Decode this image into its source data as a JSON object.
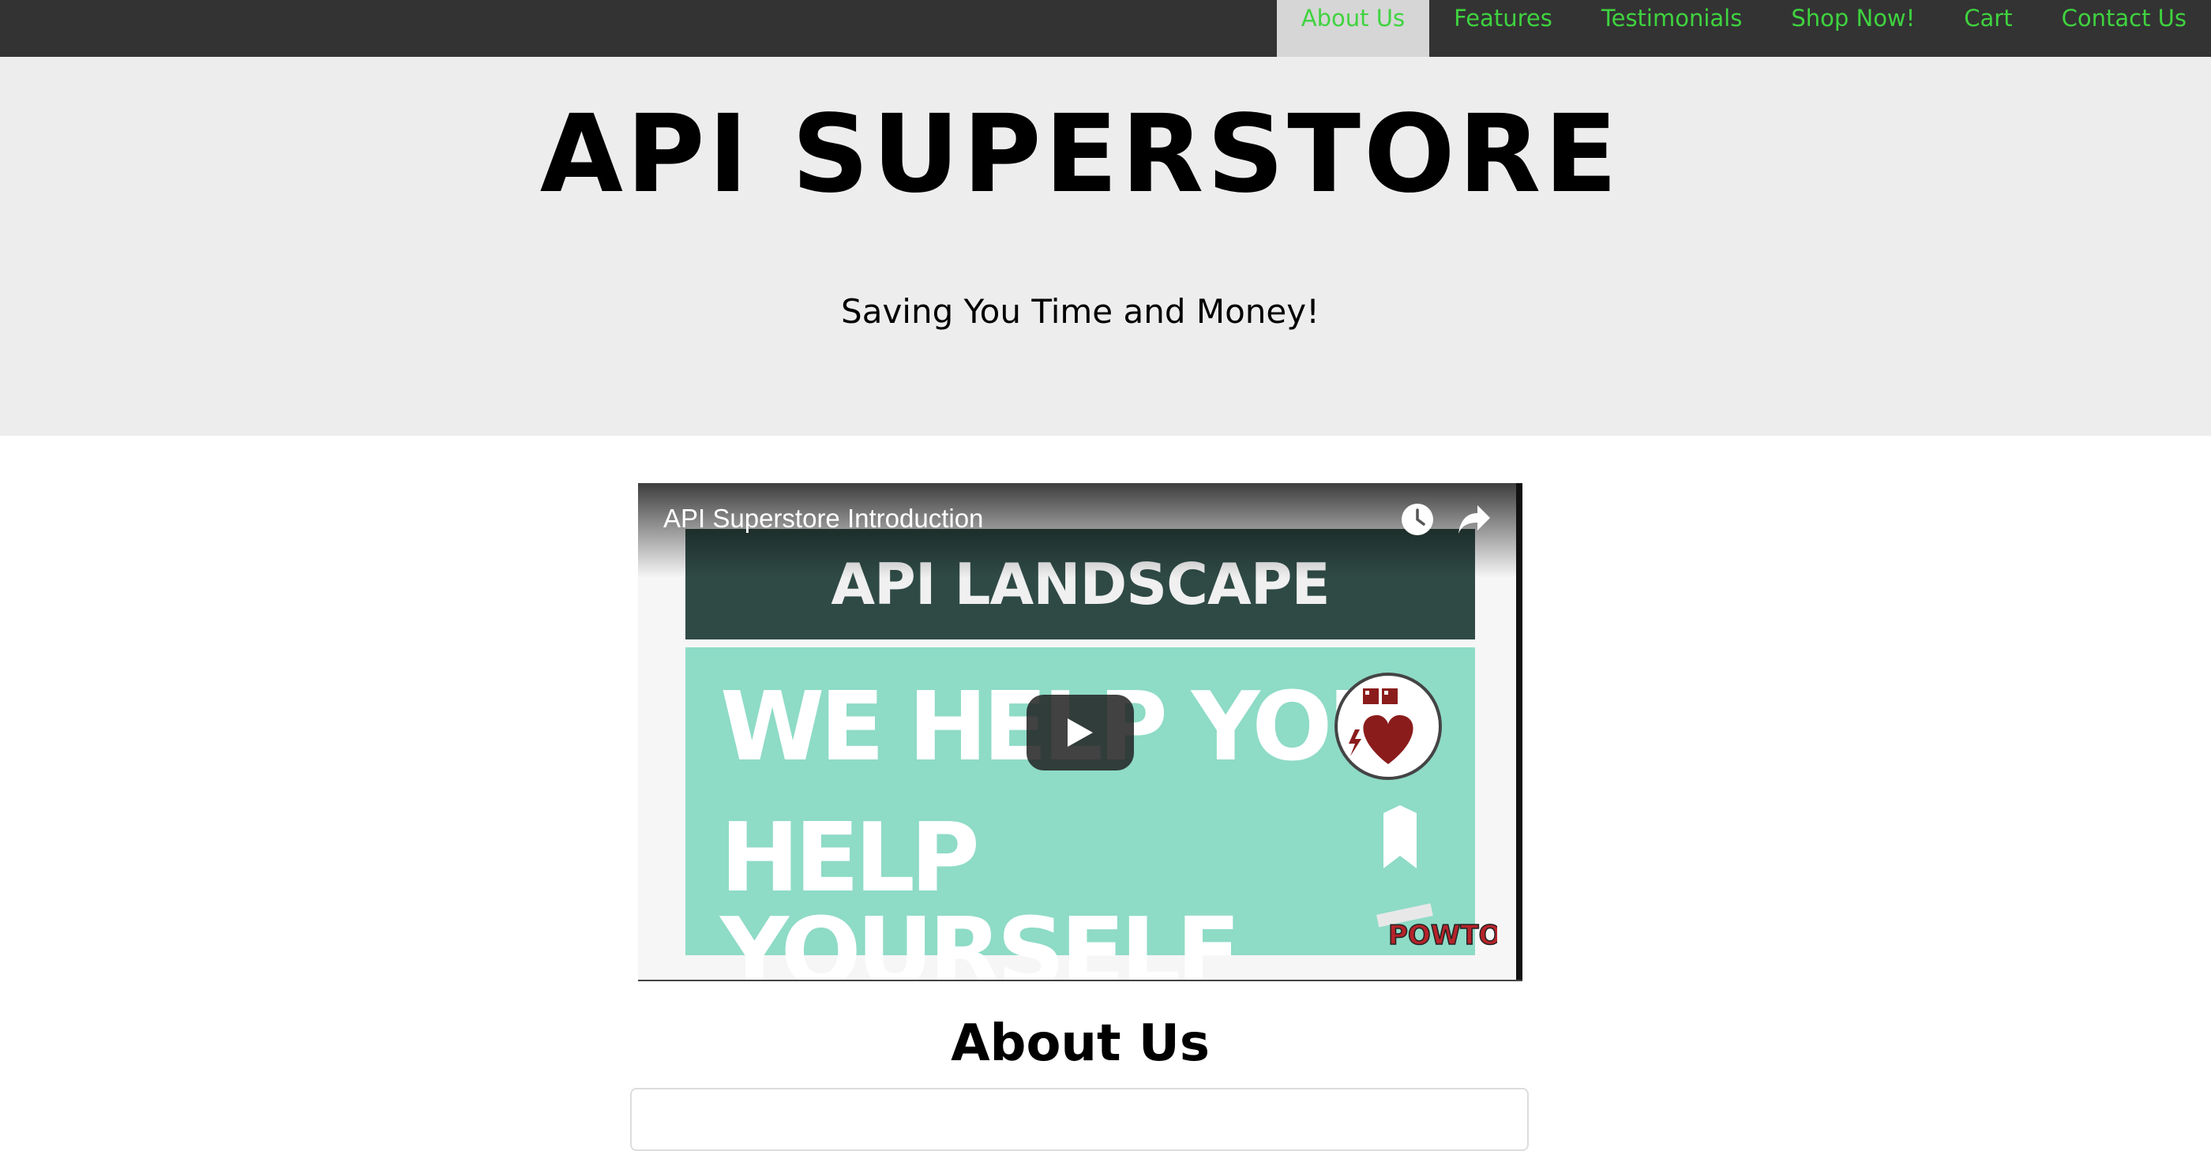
{
  "nav": {
    "items": [
      {
        "label": "About Us",
        "active": true
      },
      {
        "label": "Features",
        "active": false
      },
      {
        "label": "Testimonials",
        "active": false
      },
      {
        "label": "Shop Now!",
        "active": false
      },
      {
        "label": "Cart",
        "active": false
      },
      {
        "label": "Contact Us",
        "active": false
      }
    ],
    "link_color": "#3fd33f",
    "active_bg": "#d6d6d6",
    "bar_bg": "#333333"
  },
  "hero": {
    "title": "API SUPERSTORE",
    "tagline": "Saving You Time and Money!",
    "bg": "#ededed"
  },
  "video": {
    "title": "API Superstore Introduction",
    "banner_text": "API LANDSCAPE",
    "line_1": "WE HELP YOU",
    "line_2": "HELP YOURSELF",
    "watch_later_icon": "clock-icon",
    "share_icon": "share-icon",
    "play_icon": "play-icon",
    "panel_color": "#8edbc6",
    "banner_color": "#2f4a45"
  },
  "about": {
    "heading": "About Us"
  }
}
